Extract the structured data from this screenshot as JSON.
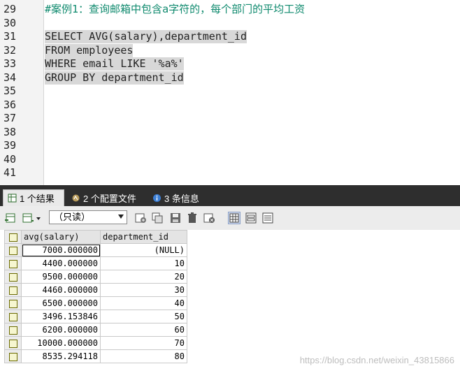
{
  "editor": {
    "lines": [
      {
        "num": "29",
        "text": "#案例1：查询邮箱中包含a字符的，每个部门的平均工资"
      },
      {
        "num": "30",
        "text": ""
      },
      {
        "num": "31",
        "text": "SELECT AVG(salary),department_id"
      },
      {
        "num": "32",
        "text": "FROM employees"
      },
      {
        "num": "33",
        "text": "WHERE email LIKE '%a%'"
      },
      {
        "num": "34",
        "text": "GROUP BY department_id"
      },
      {
        "num": "35",
        "text": ""
      },
      {
        "num": "36",
        "text": ""
      },
      {
        "num": "37",
        "text": ""
      },
      {
        "num": "38",
        "text": ""
      },
      {
        "num": "39",
        "text": ""
      },
      {
        "num": "40",
        "text": ""
      },
      {
        "num": "41",
        "text": ""
      }
    ]
  },
  "tabs": [
    {
      "label": "1 个结果",
      "icon": "table-result-icon"
    },
    {
      "label": "2 个配置文件",
      "icon": "profile-icon"
    },
    {
      "label": "3 条信息",
      "icon": "info-icon"
    }
  ],
  "toolbar": {
    "mode_select": "（只读）"
  },
  "grid": {
    "columns": [
      "avg(salary)",
      "department_id"
    ],
    "rows": [
      [
        "7000.000000",
        "(NULL)"
      ],
      [
        "4400.000000",
        "10"
      ],
      [
        "9500.000000",
        "20"
      ],
      [
        "4460.000000",
        "30"
      ],
      [
        "6500.000000",
        "40"
      ],
      [
        "3496.153846",
        "50"
      ],
      [
        "6200.000000",
        "60"
      ],
      [
        "10000.000000",
        "70"
      ],
      [
        "8535.294118",
        "80"
      ]
    ]
  },
  "watermark": "https://blog.csdn.net/weixin_43815866"
}
